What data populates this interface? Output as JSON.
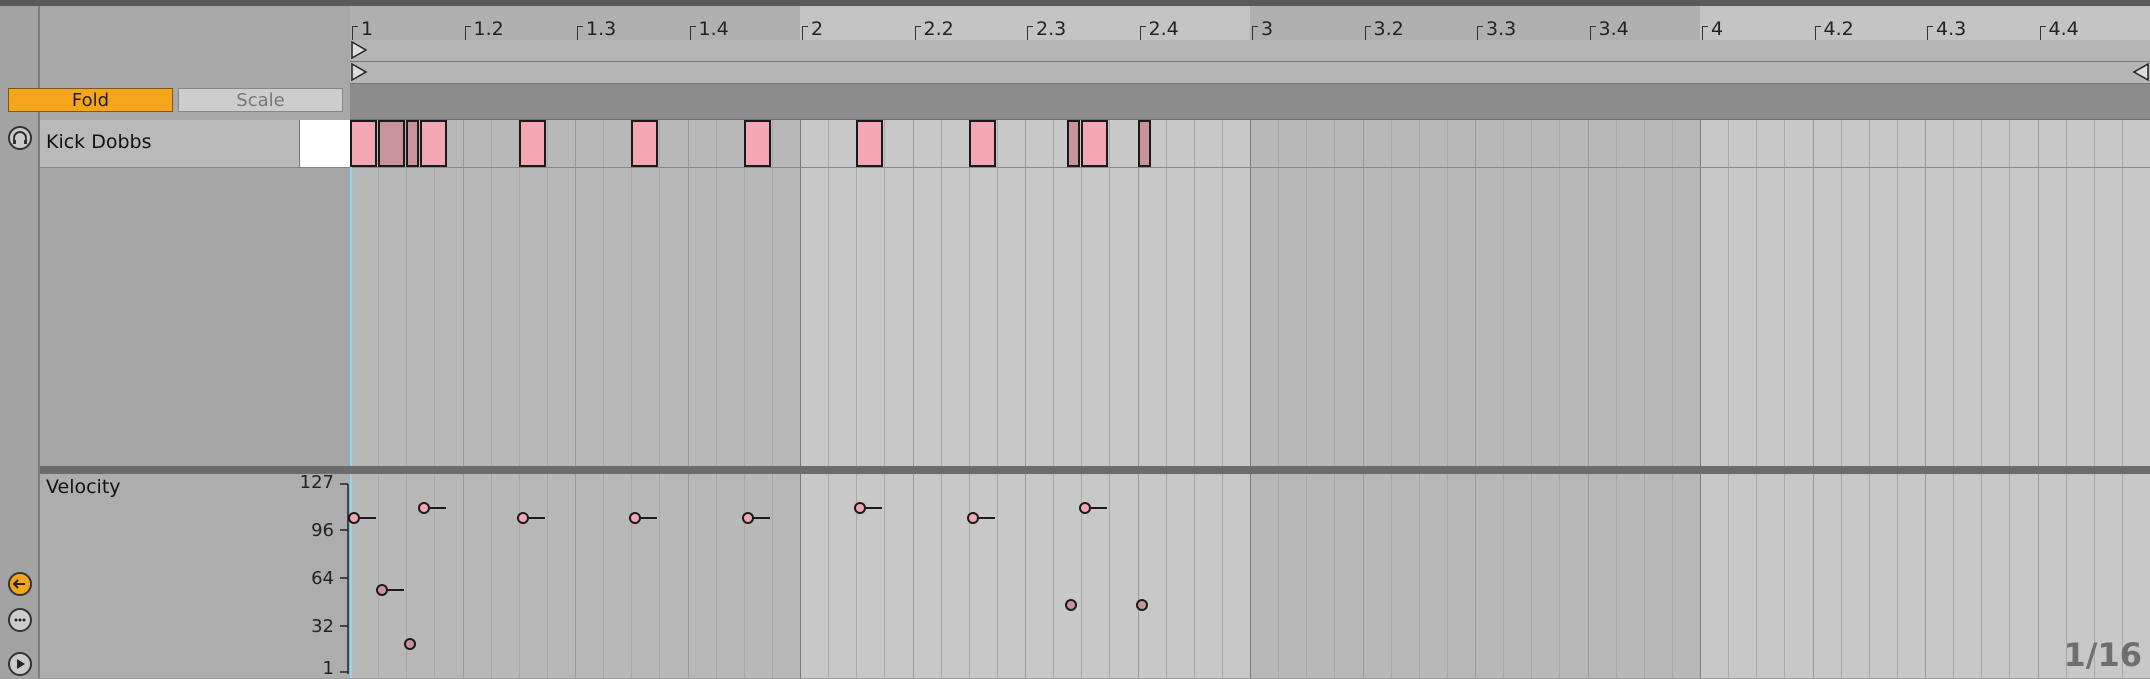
{
  "header": {
    "fold_label": "Fold",
    "scale_label": "Scale"
  },
  "ruler": {
    "labels": [
      "1",
      "1.2",
      "1.3",
      "1.4",
      "2",
      "2.2",
      "2.3",
      "2.4",
      "3",
      "3.2",
      "3.3",
      "3.4",
      "4",
      "4.2",
      "4.3",
      "4.4"
    ]
  },
  "track": {
    "name": "Kick Dobbs"
  },
  "velocity": {
    "title": "Velocity",
    "scale_labels": [
      "127",
      "96",
      "64",
      "32",
      "1"
    ]
  },
  "grid": {
    "quantization": "1/16"
  },
  "notes": [
    {
      "start_beat": 1.0,
      "length_beats": 0.25,
      "velocity": 104,
      "color": "#f3a7b2"
    },
    {
      "start_beat": 1.25,
      "length_beats": 0.25,
      "velocity": 56,
      "color": "#c9939b"
    },
    {
      "start_beat": 1.5,
      "length_beats": 0.125,
      "velocity": 20,
      "color": "#c9939b"
    },
    {
      "start_beat": 1.625,
      "length_beats": 0.25,
      "velocity": 111,
      "color": "#f3a7b2"
    },
    {
      "start_beat": 2.5,
      "length_beats": 0.25,
      "velocity": 104,
      "color": "#f3a7b2"
    },
    {
      "start_beat": 3.5,
      "length_beats": 0.25,
      "velocity": 104,
      "color": "#f3a7b2"
    },
    {
      "start_beat": 4.5,
      "length_beats": 0.25,
      "velocity": 104,
      "color": "#f3a7b2"
    },
    {
      "start_beat": 5.5,
      "length_beats": 0.25,
      "velocity": 111,
      "color": "#f3a7b2"
    },
    {
      "start_beat": 6.5,
      "length_beats": 0.25,
      "velocity": 104,
      "color": "#f3a7b2"
    },
    {
      "start_beat": 7.375,
      "length_beats": 0.125,
      "velocity": 46,
      "color": "#c9939b"
    },
    {
      "start_beat": 7.5,
      "length_beats": 0.25,
      "velocity": 111,
      "color": "#f3a7b2"
    },
    {
      "start_beat": 8.0,
      "length_beats": 0.125,
      "velocity": 46,
      "color": "#c9939b"
    }
  ],
  "colors": {
    "accent": "#f5a51a",
    "note": "#f3a7b2",
    "note_dim": "#c9939b"
  }
}
